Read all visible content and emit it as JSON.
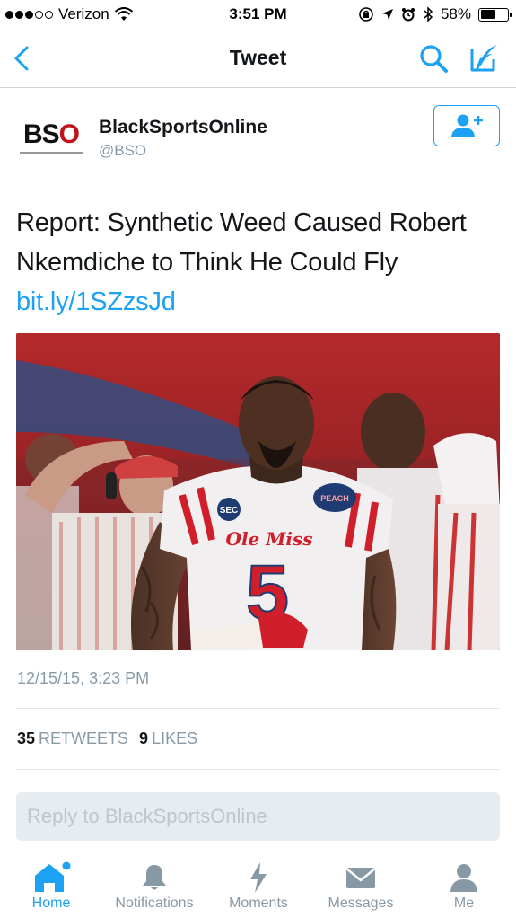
{
  "status_bar": {
    "carrier": "Verizon",
    "time": "3:51 PM",
    "battery": "58%",
    "battery_level": 0.58,
    "icons": [
      "signal-dots-icon",
      "wifi-icon",
      "rotation-lock-icon",
      "location-arrow-icon",
      "alarm-icon",
      "bluetooth-icon",
      "battery-icon"
    ]
  },
  "nav": {
    "title": "Tweet",
    "icons": [
      "back-chevron-icon",
      "search-icon",
      "compose-icon"
    ]
  },
  "tweet": {
    "avatar_text": "BSO",
    "user_name": "BlackSportsOnline",
    "handle": "@BSO",
    "text": "Report: Synthetic Weed Caused Robert Nkemdiche to Think He Could Fly ",
    "link": "bit.ly/1SZzsJd",
    "media": {
      "jersey_number": "5",
      "jersey_script": "Ole Miss",
      "patch_text": "PEACH",
      "sleeve_badge": "SEC"
    },
    "timestamp": "12/15/15, 3:23 PM",
    "retweets_count": "35",
    "retweets_label": "RETWEETS",
    "likes_count": "9",
    "likes_label": "LIKES"
  },
  "reply": {
    "placeholder": "Reply to BlackSportsOnline"
  },
  "tab_bar": {
    "tabs": [
      {
        "label": "Home",
        "icon": "home-icon",
        "active": true
      },
      {
        "label": "Notifications",
        "icon": "bell-icon",
        "active": false
      },
      {
        "label": "Moments",
        "icon": "lightning-icon",
        "active": false
      },
      {
        "label": "Messages",
        "icon": "envelope-icon",
        "active": false
      },
      {
        "label": "Me",
        "icon": "person-icon",
        "active": false
      }
    ]
  },
  "colors": {
    "accent": "#1da1f2",
    "secondary_text": "#8899a6",
    "primary_text": "#14171a",
    "jersey_red": "#d01f2b"
  }
}
